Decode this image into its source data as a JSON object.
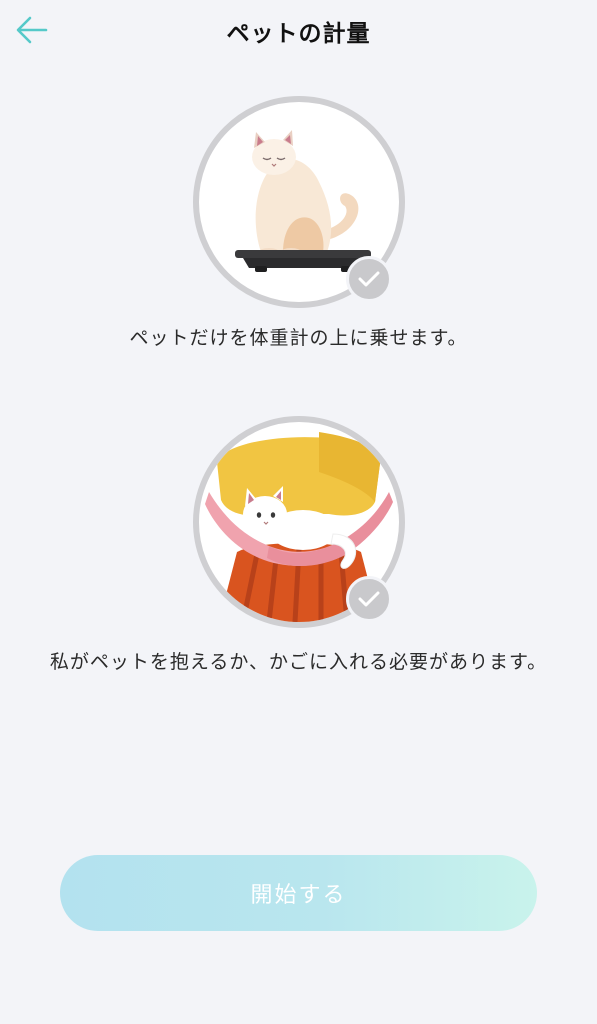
{
  "header": {
    "back_icon": "arrow-left-icon",
    "title": "ペットの計量",
    "accent_color": "#55c9c9"
  },
  "steps": [
    {
      "illustration": "cat-on-scale-illustration",
      "check_icon": "check-icon",
      "caption": "ペットだけを体重計の上に乗せます。"
    },
    {
      "illustration": "person-holding-cat-illustration",
      "check_icon": "check-icon",
      "caption": "私がペットを抱えるか、かごに入れる必要があります。"
    }
  ],
  "start_button": {
    "label": "開始する",
    "gradient": [
      "#b3e2ef",
      "#c9f3ec"
    ]
  }
}
